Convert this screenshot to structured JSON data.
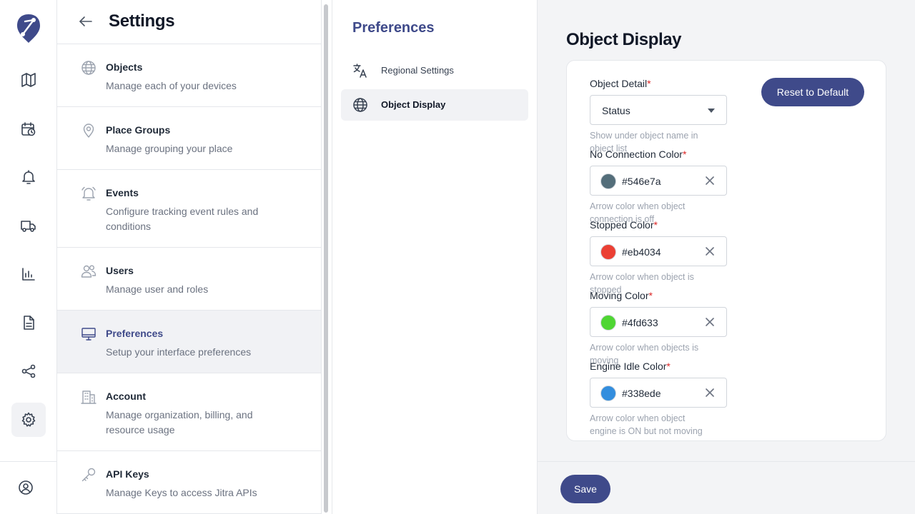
{
  "rail": {
    "logo_icon": "jitra-logo-icon",
    "items": [
      {
        "icon": "map-icon"
      },
      {
        "icon": "calendar-clock-icon"
      },
      {
        "icon": "bell-icon"
      },
      {
        "icon": "truck-icon"
      },
      {
        "icon": "bar-chart-icon"
      },
      {
        "icon": "document-icon"
      },
      {
        "icon": "share-icon"
      },
      {
        "icon": "gear-icon",
        "active": true
      }
    ],
    "profile_icon": "user-circle-icon"
  },
  "settings": {
    "title": "Settings",
    "items": [
      {
        "title": "Objects",
        "desc": "Manage each of your devices",
        "icon": "globe-icon"
      },
      {
        "title": "Place Groups",
        "desc": "Manage grouping your place",
        "icon": "map-pin-icon"
      },
      {
        "title": "Events",
        "desc": "Configure tracking event rules and conditions",
        "icon": "bell-icon"
      },
      {
        "title": "Users",
        "desc": "Manage user and roles",
        "icon": "users-icon"
      },
      {
        "title": "Preferences",
        "desc": "Setup your interface preferences",
        "icon": "monitor-icon",
        "active": true
      },
      {
        "title": "Account",
        "desc": "Manage organization, billing, and resource usage",
        "icon": "building-icon"
      },
      {
        "title": "API Keys",
        "desc": "Manage Keys to access Jitra APIs",
        "icon": "key-icon"
      }
    ]
  },
  "preferences": {
    "title": "Preferences",
    "items": [
      {
        "label": "Regional Settings",
        "icon": "translate-icon"
      },
      {
        "label": "Object Display",
        "icon": "globe-icon",
        "active": true
      }
    ]
  },
  "object_display": {
    "title": "Object Display",
    "reset_label": "Reset to Default",
    "required_mark": "*",
    "object_detail": {
      "label": "Object Detail",
      "value": "Status",
      "help": "Show under object name in object list"
    },
    "colors": [
      {
        "label": "No Connection Color",
        "value": "#546e7a",
        "swatch": "#546e7a",
        "help": "Arrow color when object connection is off"
      },
      {
        "label": "Stopped Color",
        "value": "#eb4034",
        "swatch": "#eb4034",
        "help": "Arrow color when object is stopped"
      },
      {
        "label": "Moving Color",
        "value": "#4fd633",
        "swatch": "#4fd633",
        "help": "Arrow color when objects is moving"
      },
      {
        "label": "Engine Idle Color",
        "value": "#338ede",
        "swatch": "#338ede",
        "help": "Arrow color when object engine is ON but not moving"
      }
    ],
    "save_label": "Save"
  },
  "theme": {
    "accent": "#3f4a8a",
    "active_bg": "#f1f2f5"
  }
}
